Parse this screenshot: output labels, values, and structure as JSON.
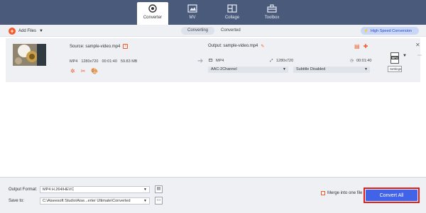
{
  "tabs": [
    {
      "label": "Converter",
      "icon": "converter-icon"
    },
    {
      "label": "MV",
      "icon": "mv-icon"
    },
    {
      "label": "Collage",
      "icon": "collage-icon"
    },
    {
      "label": "Toolbox",
      "icon": "toolbox-icon"
    }
  ],
  "toolbar": {
    "add_files": "Add Files",
    "converting": "Converting",
    "converted": "Converted",
    "high_speed": "High Speed Conversion"
  },
  "file": {
    "source_label": "Source: sample-video.mp4",
    "format": "MP4",
    "resolution": "1280x720",
    "duration": "00:01:40",
    "size": "59.83 MB",
    "output_label": "Output: sample-video.mp4",
    "out_format": "MP4",
    "out_resolution": "1280x720",
    "out_duration": "00:01:40",
    "audio": "AAC-2Channel",
    "subtitle": "Subtitle Disabled",
    "format_badge": "MP4",
    "settings": "Settings"
  },
  "bottom": {
    "output_format_label": "Output Format:",
    "output_format_value": "MP4 H.264/HEVC",
    "save_to_label": "Save to:",
    "save_to_value": "C:\\Aiseesoft Studio\\Aise...erter Ultimate\\Converted",
    "merge_label": "Merge into one file",
    "convert_all": "Convert All"
  },
  "colors": {
    "topbar": "#4a5a7a",
    "accent": "#f25a2a",
    "convert": "#4163e8",
    "highlight_border": "#e01e1e"
  }
}
